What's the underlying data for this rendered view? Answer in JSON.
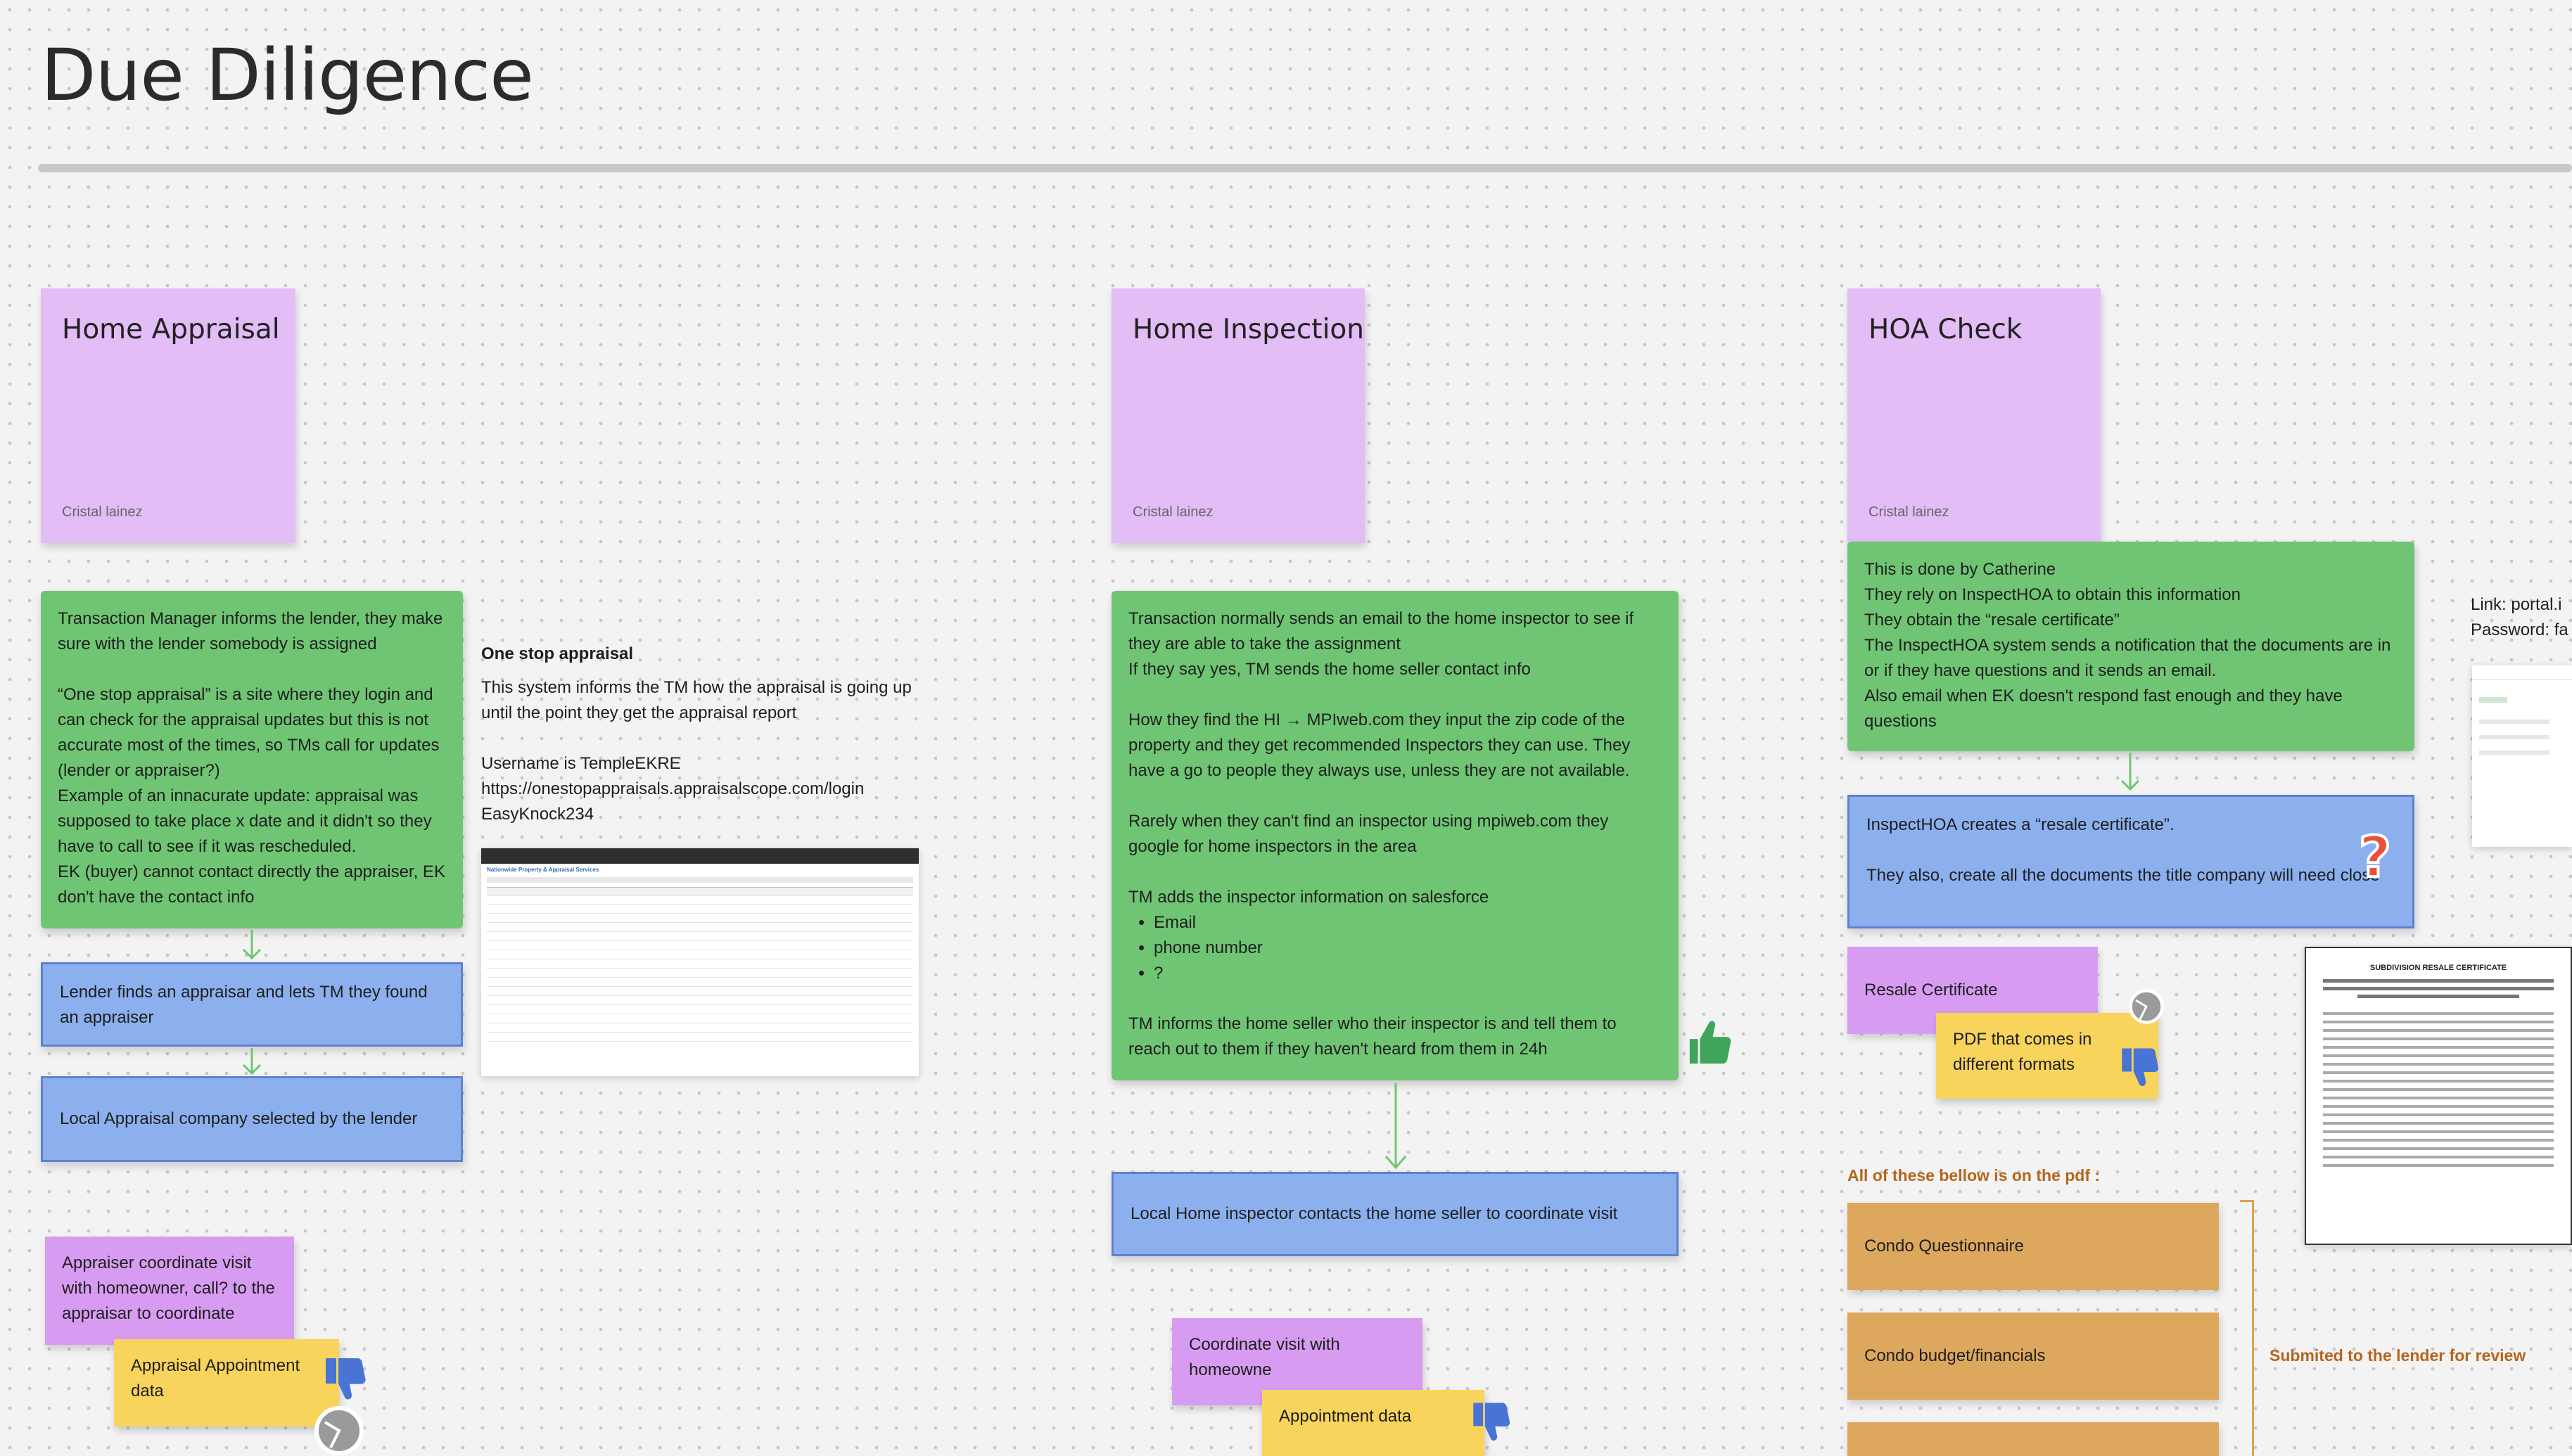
{
  "page": {
    "title": "Due Diligence"
  },
  "columns": {
    "appraisal": {
      "header": {
        "title": "Home Appraisal",
        "author": "Cristal lainez"
      },
      "info": [
        "Transaction Manager informs the lender, they make sure with the lender somebody is assigned",
        "",
        "“One stop appraisal” is a site where they login and can check for the appraisal updates but this is not accurate most of the times, so TMs call for updates (lender or appraiser?)",
        "Example of an innacurate update: appraisal was supposed to take place x date and it didn't so they have to call to see if it was rescheduled.",
        "EK (buyer) cannot contact directly the appraiser, EK don't have the contact info"
      ],
      "step1": "Lender finds an appraisar and lets TM they found an appraiser",
      "step2": "Local Appraisal company selected by the lender",
      "visit_note": "Appraiser coordinate visit with homeowner, call? to the appraisar to coordinate",
      "data_note": "Appraisal Appointment data",
      "side": {
        "heading": "One stop appraisal",
        "body": "This system informs the TM how the appraisal is going up until the point they get the appraisal report",
        "username": "Username is TempleEKRE",
        "url": "https://onestopappraisals.appraisalscope.com/login",
        "password": "EasyKnock234",
        "screenshot_title": "Nationwide Property & Appraisal Services"
      }
    },
    "inspection": {
      "header": {
        "title": "Home Inspection",
        "author": "Cristal lainez"
      },
      "info": {
        "p1": "Transaction normally sends an email to the home inspector to see if they are able to take the assignment",
        "p2": "If they say yes, TM sends the home seller contact info",
        "p3": "How they find the HI → MPIweb.com they input the zip code of the property and they get recommended Inspectors they can use. They have a go to people they always use, unless they are not available.",
        "p4": "Rarely when they can't find an inspector using mpiweb.com they google for home inspectors in the area",
        "p5": "TM adds the inspector information on salesforce",
        "bullets": [
          "Email",
          "phone number",
          "?"
        ],
        "p6": "TM informs the home seller who their inspector is and tell them to reach out to them if they haven't heard from them in 24h"
      },
      "step1": "Local Home inspector contacts the home seller to coordinate visit",
      "visit_note": "Coordinate visit with homeowne",
      "data_note": "Appointment data"
    },
    "hoa": {
      "header": {
        "title": "HOA Check",
        "author": "Cristal lainez"
      },
      "info": [
        "This is done by Catherine",
        "They rely on InspectHOA to obtain this information",
        "They obtain the “resale certificate”",
        "The InspectHOA system sends a notification that the documents are in or if they have questions and it sends an email.",
        "Also email when EK doesn't respond fast enough and they have questions"
      ],
      "step1": {
        "line1": "InspectHOA creates a “resale certificate”.",
        "line2": "They also, create all the documents the title company will need close"
      },
      "resale": "Resale Certificate",
      "pdf_note": "PDF that comes in different formats",
      "pdf_label": "All of these bellow is on the pdf :",
      "docs": [
        "Condo Questionnaire",
        "Condo budget/financials"
      ],
      "submitted": "Submited to the lender for review",
      "link_label": "Link: portal.i",
      "password_label": "Password: fa",
      "certificate_title": "SUBDIVISION RESALE CERTIFICATE"
    }
  },
  "colors": {
    "green": "#6fc573",
    "blue": "#8cb0ee",
    "purple": "#d79cf2",
    "header": "#e3bdf6",
    "yellow": "#f8d45c",
    "orange": "#dda85e"
  }
}
